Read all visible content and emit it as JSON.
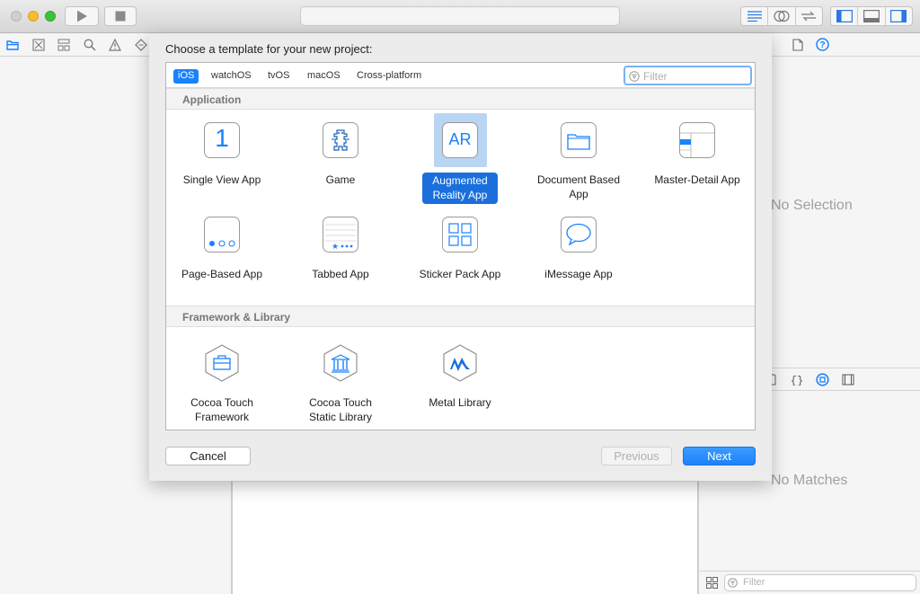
{
  "toolbar": {
    "activity_text": ""
  },
  "sheet": {
    "title": "Choose a template for your new project:",
    "tabs": [
      "iOS",
      "watchOS",
      "tvOS",
      "macOS",
      "Cross-platform"
    ],
    "active_tab": "iOS",
    "filter_placeholder": "Filter",
    "sections": {
      "application": "Application",
      "framework": "Framework & Library"
    },
    "templates": {
      "single_view": "Single View App",
      "game": "Game",
      "ar_line1": "Augmented",
      "ar_line2": "Reality App",
      "document_line1": "Document Based",
      "document_line2": "App",
      "master_detail": "Master-Detail App",
      "page_based": "Page-Based App",
      "tabbed": "Tabbed App",
      "sticker_pack": "Sticker Pack App",
      "imessage": "iMessage App",
      "cocoa_fw_line1": "Cocoa Touch",
      "cocoa_fw_line2": "Framework",
      "cocoa_lib_line1": "Cocoa Touch",
      "cocoa_lib_line2": "Static Library",
      "metal_library": "Metal Library"
    },
    "icon_text": {
      "single_view_number": "1",
      "ar": "AR"
    },
    "buttons": {
      "cancel": "Cancel",
      "previous": "Previous",
      "next": "Next"
    }
  },
  "inspector": {
    "no_selection": "No Selection",
    "no_matches": "No Matches",
    "library_filter_placeholder": "Filter"
  },
  "colors": {
    "accent": "#1a82fb",
    "selection_highlight": "#b9d5f3"
  }
}
